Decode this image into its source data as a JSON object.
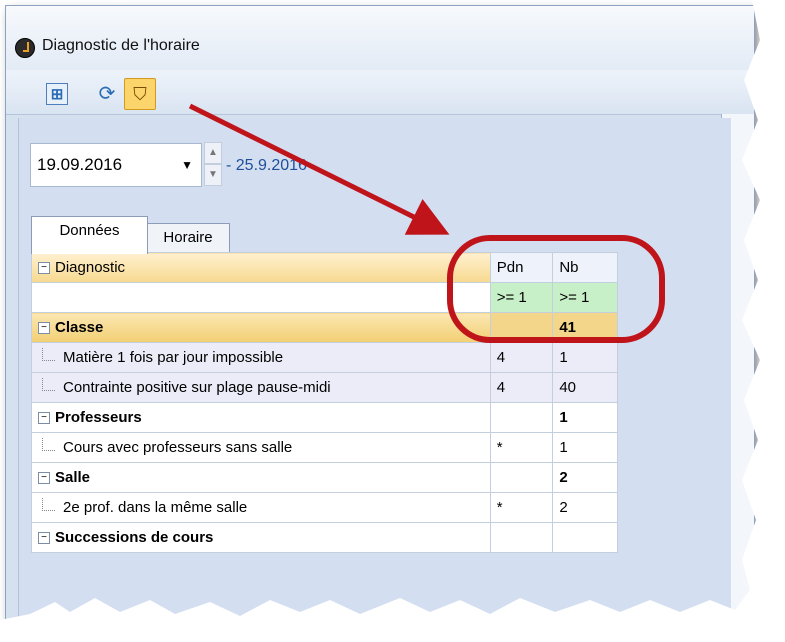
{
  "window": {
    "title": "Diagnostic de l'horaire"
  },
  "toolbar": {
    "new_icon": "⊞",
    "sync_icon": "⟳",
    "filter_icon": "⛉"
  },
  "date": {
    "start": "19.09.2016",
    "end": "- 25.9.2016",
    "arrow": "▼",
    "up": "▲",
    "down": "▼"
  },
  "tabs": {
    "data": "Données",
    "schedule": "Horaire"
  },
  "grid": {
    "header": {
      "col0": "Diagnostic",
      "col1": "Pdn",
      "col2": "Nb",
      "expander": "−"
    },
    "filter": {
      "col1": ">= 1",
      "col2": ">= 1"
    },
    "rows": [
      {
        "label": "Classe",
        "pdn": "",
        "nb": "41",
        "expander": "−"
      },
      {
        "label": "Matière 1 fois par jour impossible",
        "pdn": "4",
        "nb": "1"
      },
      {
        "label": "Contrainte positive sur plage pause-midi",
        "pdn": "4",
        "nb": "40"
      },
      {
        "label": "Professeurs",
        "pdn": "",
        "nb": "1",
        "expander": "−"
      },
      {
        "label": "Cours avec professeurs sans salle",
        "pdn": "*",
        "nb": "1"
      },
      {
        "label": "Salle",
        "pdn": "",
        "nb": "2",
        "expander": "−"
      },
      {
        "label": "2e prof. dans la même salle",
        "pdn": "*",
        "nb": "2"
      },
      {
        "label": "Successions de cours",
        "pdn": "",
        "nb": "",
        "expander": "−"
      }
    ]
  },
  "colors": {
    "highlight_ring": "#c0141b",
    "arrow": "#c0141b"
  }
}
